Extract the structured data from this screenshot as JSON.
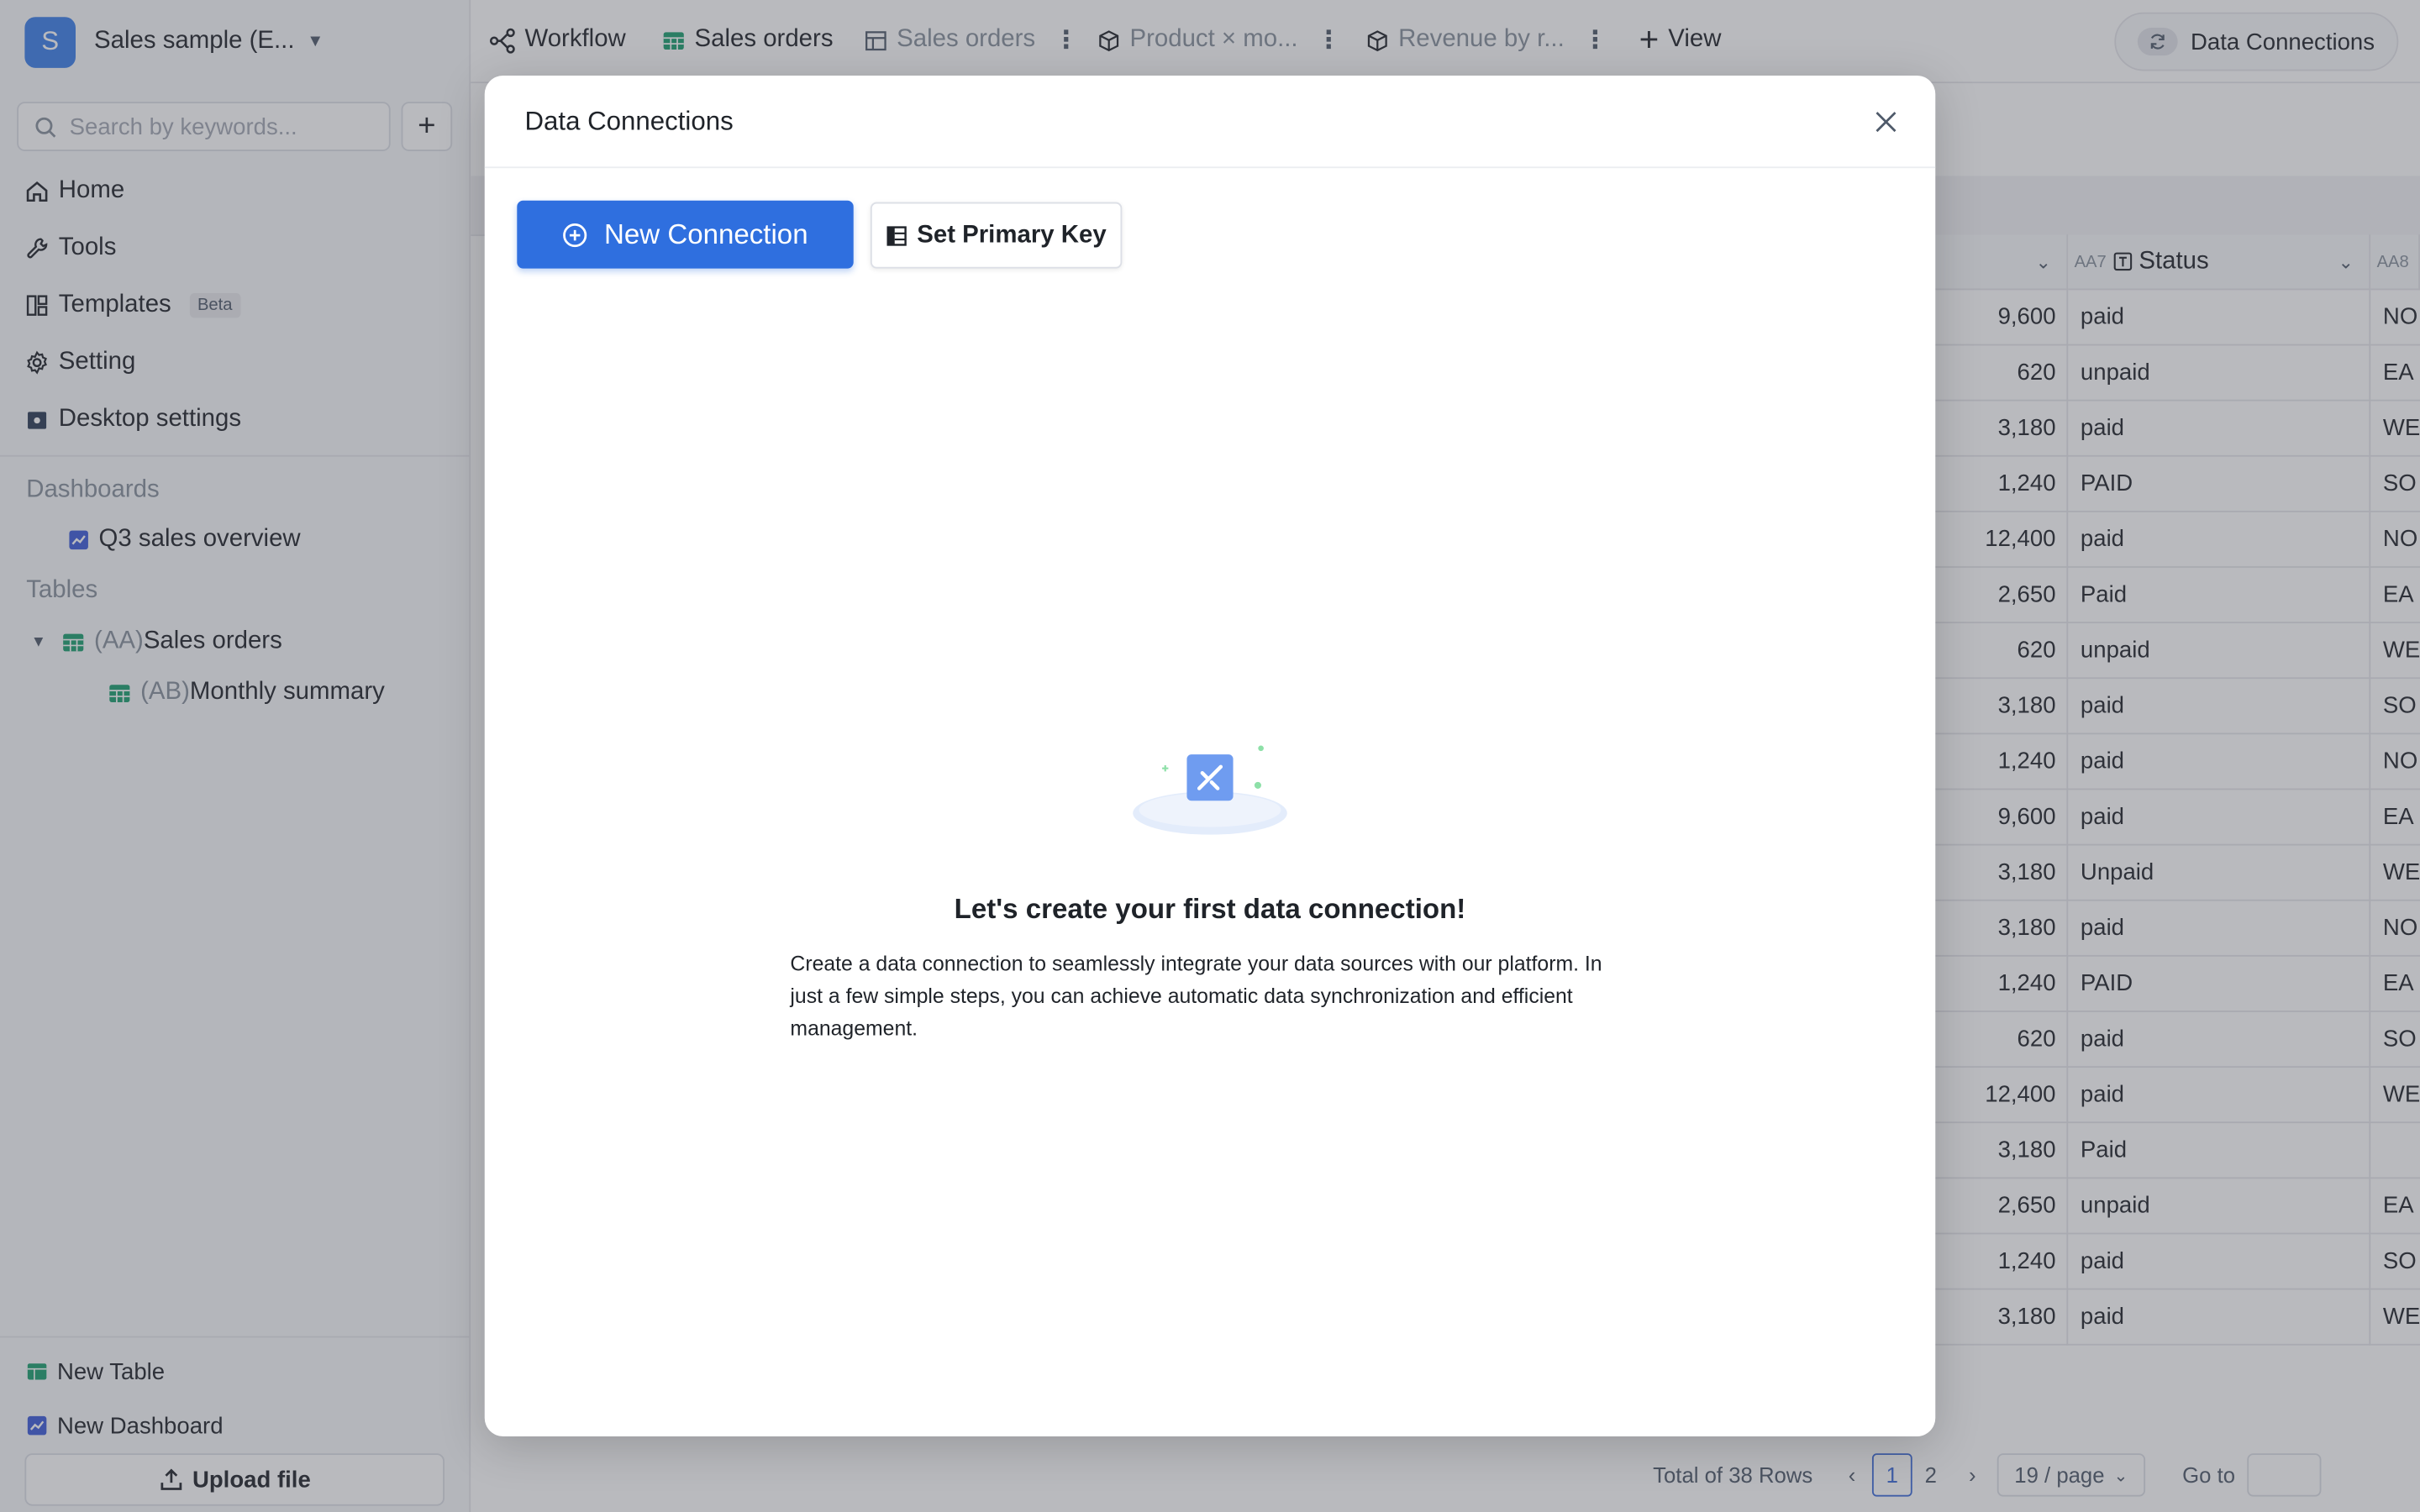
{
  "workspace": {
    "initial": "S",
    "name": "Sales sample (E..."
  },
  "sidebar": {
    "search_placeholder": "Search by keywords...",
    "nav": [
      {
        "label": "Home"
      },
      {
        "label": "Tools"
      },
      {
        "label": "Templates",
        "badge": "Beta"
      },
      {
        "label": "Setting"
      },
      {
        "label": "Desktop settings"
      }
    ],
    "dashboards_title": "Dashboards",
    "dashboards": [
      {
        "label": "Q3 sales overview"
      }
    ],
    "tables_title": "Tables",
    "tables": [
      {
        "code": "(AA)",
        "label": "Sales orders"
      },
      {
        "code": "(AB)",
        "label": "Monthly summary"
      }
    ],
    "bottom": {
      "new_table": "New Table",
      "new_dashboard": "New Dashboard",
      "upload": "Upload file"
    }
  },
  "topbar": {
    "tabs": [
      {
        "label": "Workflow"
      },
      {
        "label": "Sales orders"
      },
      {
        "label": "Sales orders"
      },
      {
        "label": "Product × mo..."
      },
      {
        "label": "Revenue by r..."
      }
    ],
    "add_view": "View",
    "data_connections": "Data Connections"
  },
  "table": {
    "status_col_code": "AA7",
    "status_col_label": "Status",
    "next_col_code": "AA8",
    "rows": [
      {
        "amount": "9,600",
        "status": "paid",
        "region": "NO"
      },
      {
        "amount": "620",
        "status": "unpaid",
        "region": "EA"
      },
      {
        "amount": "3,180",
        "status": "paid",
        "region": "WE"
      },
      {
        "amount": "1,240",
        "status": "PAID",
        "region": "SO"
      },
      {
        "amount": "12,400",
        "status": "paid",
        "region": "NO"
      },
      {
        "amount": "2,650",
        "status": "Paid",
        "region": "EA"
      },
      {
        "amount": "620",
        "status": "unpaid",
        "region": "WE"
      },
      {
        "amount": "3,180",
        "status": "paid",
        "region": "SO"
      },
      {
        "amount": "1,240",
        "status": "paid",
        "region": "NO"
      },
      {
        "amount": "9,600",
        "status": "paid",
        "region": "EA"
      },
      {
        "amount": "3,180",
        "status": "Unpaid",
        "region": "WE"
      },
      {
        "amount": "3,180",
        "status": "paid",
        "region": "NO"
      },
      {
        "amount": "1,240",
        "status": "PAID",
        "region": "EA"
      },
      {
        "amount": "620",
        "status": "paid",
        "region": "SO"
      },
      {
        "amount": "12,400",
        "status": "paid",
        "region": "WE"
      },
      {
        "amount": "3,180",
        "status": "Paid",
        "region": ""
      },
      {
        "amount": "2,650",
        "status": "unpaid",
        "region": "EA"
      },
      {
        "amount": "1,240",
        "status": "paid",
        "region": "SO"
      },
      {
        "amount": "3,180",
        "status": "paid",
        "region": "WE"
      }
    ],
    "total_rows": "Total of 38 Rows",
    "pages": [
      "1",
      "2"
    ],
    "page_size": "19 / page",
    "goto_label": "Go to"
  },
  "modal": {
    "title": "Data Connections",
    "new_connection": "New Connection",
    "set_primary_key": "Set Primary Key",
    "empty_title": "Let's create your first data connection!",
    "empty_desc": "Create a data connection to seamlessly integrate your data sources with our platform. In just a few simple steps, you can achieve automatic data synchronization and efficient management."
  },
  "colors": {
    "primary": "#2f6fdf",
    "avatar": "#3b7ee8",
    "table_icon": "#1a9e6e",
    "dashboard_icon": "#3d5bd9"
  }
}
